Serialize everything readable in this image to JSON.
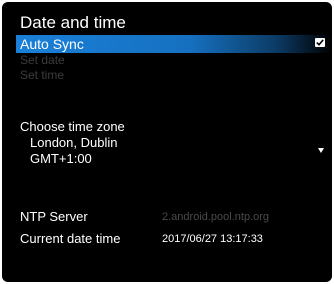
{
  "title": "Date and time",
  "auto_sync": {
    "label": "Auto Sync",
    "checked": true
  },
  "set_date": {
    "label": "Set date"
  },
  "set_time": {
    "label": "Set time"
  },
  "time_zone": {
    "label": "Choose time zone",
    "city": "London, Dublin",
    "offset": "GMT+1:00",
    "icon": "dropdown-arrow-icon"
  },
  "ntp_server": {
    "label": "NTP Server",
    "value": "2.android.pool.ntp.org"
  },
  "current_date_time": {
    "label": "Current date time",
    "value": "2017/06/27 13:17:33"
  },
  "colors": {
    "background": "#000000",
    "highlight": "#1a80d8",
    "disabled_text": "#3c3c3c",
    "ntp_value": "#4a4a4a",
    "text": "#ffffff"
  }
}
